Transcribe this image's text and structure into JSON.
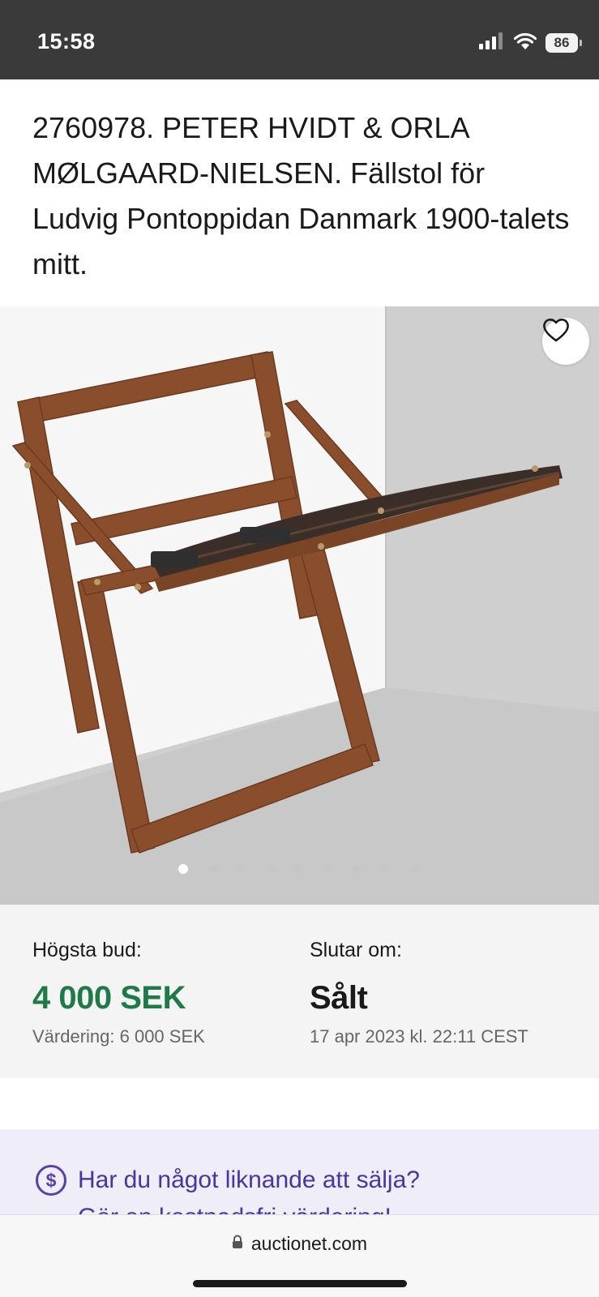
{
  "status_bar": {
    "time": "15:58",
    "battery": "86",
    "icons": [
      "signal-icon",
      "wifi-icon",
      "battery-icon"
    ]
  },
  "lot": {
    "title": "2760978. PETER HVIDT & ORLA MØLGAARD-NIELSEN. Fällstol för Ludvig Pontoppidan Danmark 1900-talets mitt."
  },
  "gallery": {
    "image_count": 9,
    "active_index": 0,
    "favorite_icon": "heart-icon"
  },
  "bid": {
    "highest_label": "Högsta bud:",
    "highest_value": "4 000 SEK",
    "estimate": "Värdering: 6 000 SEK",
    "ends_label": "Slutar om:",
    "ends_value": "Sålt",
    "ends_date": "17 apr 2023 kl. 22:11 CEST"
  },
  "sell_banner": {
    "icon": "dollar-circle-icon",
    "text": "Har du något liknande att sälja?",
    "subtext": "Gör en kostnadsfri värdering!"
  },
  "browser": {
    "url": "auctionet.com",
    "icon": "lock-icon"
  },
  "colors": {
    "status_bar_bg": "#3a3a3a",
    "price_green": "#1e7a47",
    "banner_bg": "#eeedf8",
    "banner_text": "#4a35a0"
  }
}
